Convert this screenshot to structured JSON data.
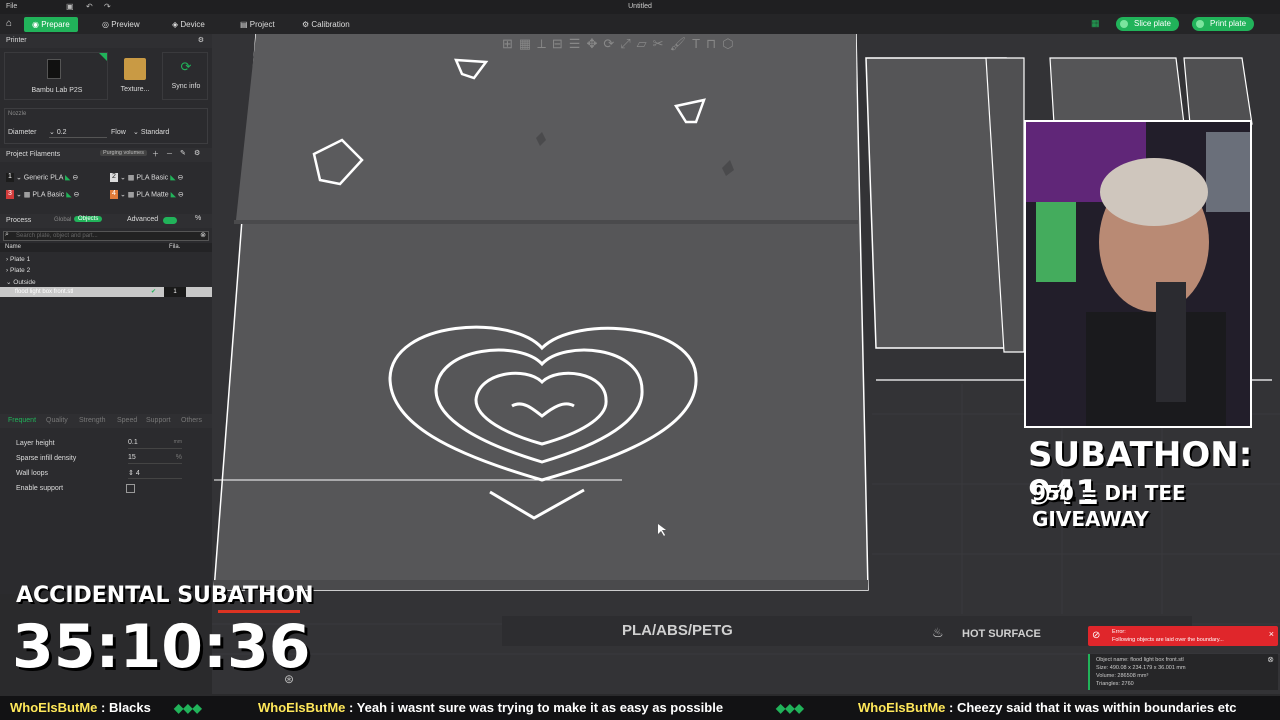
{
  "title_bar": {
    "title": "Untitled",
    "file_label": "File"
  },
  "tabs": [
    {
      "label": "Prepare",
      "active": true
    },
    {
      "label": "Preview",
      "active": false
    },
    {
      "label": "Device",
      "active": false
    },
    {
      "label": "Project",
      "active": false
    },
    {
      "label": "Calibration",
      "active": false
    }
  ],
  "actions": {
    "slice": "Slice plate",
    "print": "Print plate"
  },
  "printer": {
    "section_label": "Printer",
    "model": "Bambu Lab P2S",
    "texture": "Texture...",
    "sync": "Sync info",
    "nozzle_label": "Nozzle",
    "diameter_label": "Diameter",
    "diameter_value": "0.2",
    "flow_label": "Flow",
    "flow_value": "Standard"
  },
  "filaments": {
    "section_label": "Project Filaments",
    "purge_label": "Purging volumes",
    "items": [
      {
        "num": "1",
        "name": "Generic PLA",
        "color": "#1c1c1c"
      },
      {
        "num": "2",
        "name": "PLA Basic",
        "color": "#dcdcdc"
      },
      {
        "num": "3",
        "name": "PLA Basic",
        "color": "#d23b3b"
      },
      {
        "num": "4",
        "name": "PLA Matte",
        "color": "#e07c3a"
      }
    ]
  },
  "process": {
    "section_label": "Process",
    "global_label": "Global",
    "objects_label": "Objects",
    "advanced_label": "Advanced",
    "search_placeholder": "Search plate, object and part...",
    "col_name": "Name",
    "col_fila": "Fila.",
    "tree": [
      "Plate 1",
      "Plate 2",
      "Outside",
      "flood light box front.stl"
    ],
    "selected_fila": "1"
  },
  "settings": {
    "tabs": [
      "Frequent",
      "Quality",
      "Strength",
      "Speed",
      "Support",
      "Others"
    ],
    "params": [
      {
        "label": "Layer height",
        "value": "0.1",
        "unit": "mm"
      },
      {
        "label": "Sparse infill density",
        "value": "15",
        "unit": "%"
      },
      {
        "label": "Wall loops",
        "value": "4",
        "unit": ""
      },
      {
        "label": "Enable support",
        "value": "",
        "unit": ""
      }
    ]
  },
  "bed": {
    "label_filament": "PLA/ABS/PETG",
    "label_hot": "HOT SURFACE"
  },
  "error": {
    "title": "Error:",
    "message": "Following objects are laid over the boundary...",
    "info": [
      "Object name: flood light box front.stl",
      "Size: 490.08 x 234.179 x 36.001 mm",
      "Volume: 286508 mm³",
      "Triangles: 2760"
    ]
  },
  "stream": {
    "subathon_count": "SUBATHON: 941",
    "giveaway": "950 = DH TEE GIVEAWAY",
    "accidental": "ACCIDENTAL SUBATHON",
    "timer": "35:10:36"
  },
  "chat": [
    {
      "user": "WhoElsButMe",
      "msg": "Blacks"
    },
    {
      "user": "WhoElsButMe",
      "msg": "Yeah i wasnt sure was trying to make it as easy as possible"
    },
    {
      "user": "WhoElsButMe",
      "msg": "Cheezy said that it was within boundaries etc"
    }
  ],
  "colors": {
    "accent": "#21b35a",
    "error": "#e0262b",
    "panel": "#2b2b2e"
  }
}
